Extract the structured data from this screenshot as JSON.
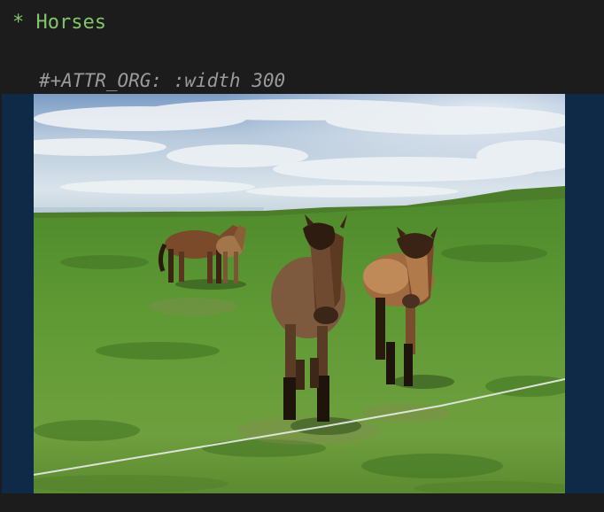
{
  "heading": {
    "star": "*",
    "title": "Horses"
  },
  "attr_line": "#+ATTR_ORG: :width 300",
  "colors": {
    "background": "#1c1c1c",
    "heading": "#82c468",
    "attr": "#9a9a9a",
    "image_margin": "#0f2a47"
  },
  "image": {
    "subject": "three brown horses standing in a green field with cloudy sky and water in the distance"
  }
}
